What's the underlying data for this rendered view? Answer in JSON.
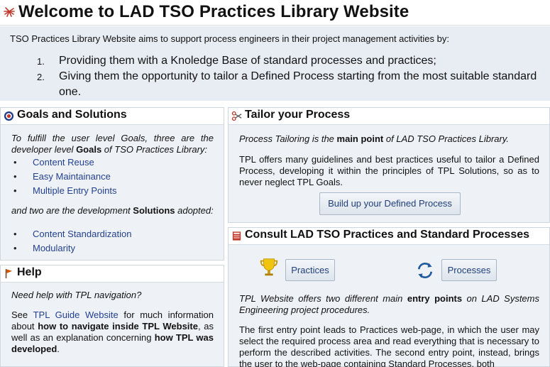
{
  "header": {
    "title": "Welcome to LAD TSO Practices Library Website",
    "logo_icon": "spiral-logo-icon"
  },
  "intro": {
    "text": "TSO Practices Library Website aims to support process engineers in their project management activities by:",
    "items": [
      {
        "num": "1.",
        "text": "Providing  them with a Knoledge Base of standard processes and practices;"
      },
      {
        "num": "2.",
        "text": "Giving them the opportunity to tailor a Defined Process starting from the most suitable standard one."
      }
    ]
  },
  "goals": {
    "title": "Goals and Solutions",
    "icon": "target-icon",
    "intro_1": "To fulfill the user level Goals, three are the developer level ",
    "intro_bold": "Goals",
    "intro_2": " of TSO Practices Library:",
    "goal_items": [
      "Content Reuse",
      "Easy Maintainance",
      "Multiple Entry Points"
    ],
    "sol_1": "and two are the development ",
    "sol_bold": "Solutions",
    "sol_2": " adopted:",
    "solution_items": [
      "Content Standardization",
      "Modularity"
    ]
  },
  "help": {
    "title": "Help",
    "icon": "flag-icon",
    "question": "Need help with TPL navigation?",
    "t1": "See ",
    "link": "TPL Guide Website",
    "t2": " for much information about ",
    "b1": "how to navigate inside TPL Website",
    "t3": ", as well as an explanation concerning ",
    "b2": "how TPL was developed",
    "t4": "."
  },
  "tailor": {
    "title": "Tailor your Process",
    "icon": "scissors-icon",
    "p1_a": "Process Tailoring is the ",
    "p1_bold": "main point",
    "p1_b": " of LAD TSO Practices Library.",
    "p2": "TPL offers many guidelines and best practices useful to tailor a Defined Process, developing it within the principles of TPL Solutions, so as to never neglect TPL Goals.",
    "button": "Build up your Defined Process"
  },
  "consult": {
    "title": "Consult LAD TSO Practices and Standard Processes",
    "icon": "book-icon",
    "practices_button": "Practices",
    "practices_icon": "trophy-icon",
    "processes_button": "Processes",
    "processes_icon": "refresh-cycle-icon",
    "p1_a": "TPL Website offers two different main ",
    "p1_bold": "entry points",
    "p1_b": " on LAD Systems Engineering project procedures.",
    "p2": "The first entry point leads to Practices web-page, in which the user may select the required process area and read everything that is necessary to perform the described activities. The second entry point, instead, brings the user to the web-page containing Standard Processes, both"
  },
  "colors": {
    "panel_bg": "#eef2f6",
    "intro_bg": "#e8edf3",
    "link": "#23408e",
    "button_text": "#1f3f78"
  }
}
